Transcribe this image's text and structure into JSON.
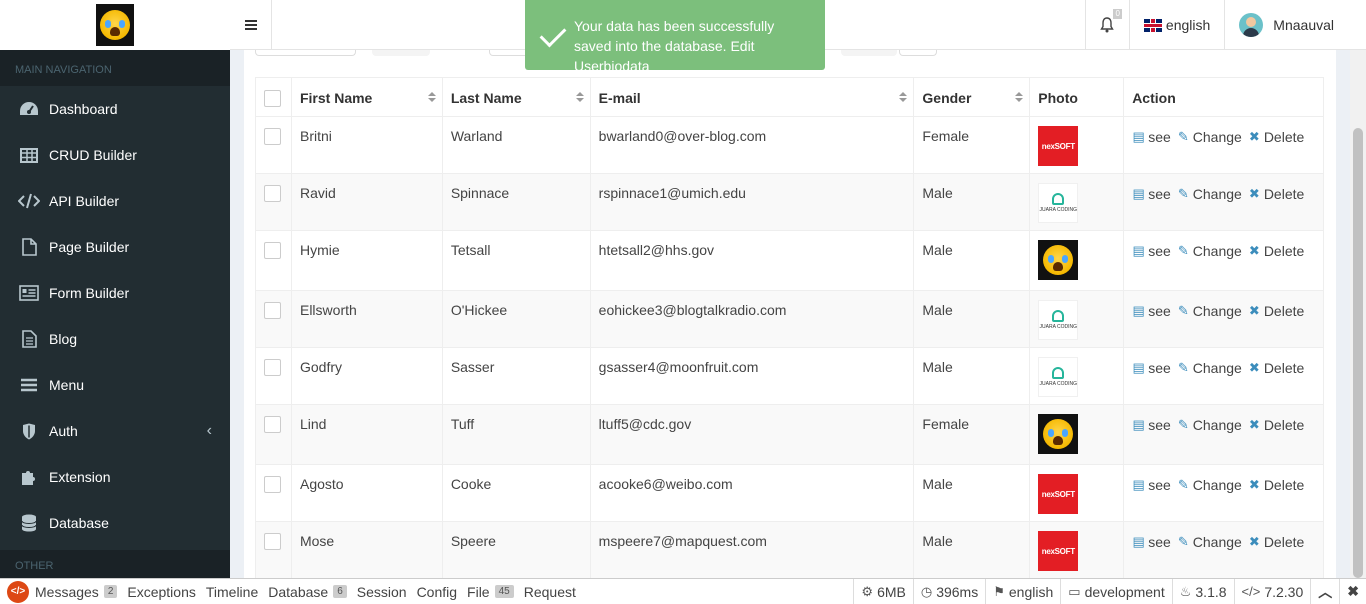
{
  "header": {
    "notifications_count": "0",
    "language": "english",
    "user_name": "Mnaauval"
  },
  "sidebar": {
    "main_nav_label": "MAIN NAVIGATION",
    "other_label": "OTHER",
    "items": [
      {
        "label": "Dashboard",
        "icon": "dashboard-icon"
      },
      {
        "label": "CRUD Builder",
        "icon": "table-icon"
      },
      {
        "label": "API Builder",
        "icon": "code-icon"
      },
      {
        "label": "Page Builder",
        "icon": "file-icon"
      },
      {
        "label": "Form Builder",
        "icon": "form-icon"
      },
      {
        "label": "Blog",
        "icon": "document-icon"
      },
      {
        "label": "Menu",
        "icon": "bars-icon"
      },
      {
        "label": "Auth",
        "icon": "shield-icon"
      },
      {
        "label": "Extension",
        "icon": "puzzle-icon"
      },
      {
        "label": "Database",
        "icon": "database-icon"
      }
    ]
  },
  "toast": {
    "message": "Your data has been successfully saved into the database. Edit Userbiodata"
  },
  "table": {
    "columns": [
      "First Name",
      "Last Name",
      "E-mail",
      "Gender",
      "Photo",
      "Action"
    ],
    "actions": {
      "see": "see",
      "change": "Change",
      "delete": "Delete"
    },
    "rows": [
      {
        "first": "Britni",
        "last": "Warland",
        "email": "bwarland0@over-blog.com",
        "gender": "Female",
        "photo": "nexsoft-logo",
        "photo_text": "nexSOFT"
      },
      {
        "first": "Ravid",
        "last": "Spinnace",
        "email": "rspinnace1@umich.edu",
        "gender": "Male",
        "photo": "juara-coding-logo",
        "photo_text": "JUARA CODING"
      },
      {
        "first": "Hymie",
        "last": "Tetsall",
        "email": "htetsall2@hhs.gov",
        "gender": "Male",
        "photo": "crying-emoji",
        "photo_text": ""
      },
      {
        "first": "Ellsworth",
        "last": "O'Hickee",
        "email": "eohickee3@blogtalkradio.com",
        "gender": "Male",
        "photo": "juara-coding-logo",
        "photo_text": "JUARA CODING"
      },
      {
        "first": "Godfry",
        "last": "Sasser",
        "email": "gsasser4@moonfruit.com",
        "gender": "Male",
        "photo": "juara-coding-logo",
        "photo_text": "JUARA CODING"
      },
      {
        "first": "Lind",
        "last": "Tuff",
        "email": "ltuff5@cdc.gov",
        "gender": "Female",
        "photo": "crying-emoji",
        "photo_text": ""
      },
      {
        "first": "Agosto",
        "last": "Cooke",
        "email": "acooke6@weibo.com",
        "gender": "Male",
        "photo": "nexsoft-logo",
        "photo_text": "nexSOFT"
      },
      {
        "first": "Mose",
        "last": "Speere",
        "email": "mspeere7@mapquest.com",
        "gender": "Male",
        "photo": "nexsoft-logo",
        "photo_text": "nexSOFT"
      }
    ]
  },
  "debugbar": {
    "tabs": [
      {
        "label": "Messages",
        "badge": "2"
      },
      {
        "label": "Exceptions",
        "badge": ""
      },
      {
        "label": "Timeline",
        "badge": ""
      },
      {
        "label": "Database",
        "badge": "6"
      },
      {
        "label": "Session",
        "badge": ""
      },
      {
        "label": "Config",
        "badge": ""
      },
      {
        "label": "File",
        "badge": "45"
      },
      {
        "label": "Request",
        "badge": ""
      }
    ],
    "memory": "6MB",
    "time": "396ms",
    "locale": "english",
    "env": "development",
    "version": "3.1.8",
    "php": "7.2.30"
  }
}
